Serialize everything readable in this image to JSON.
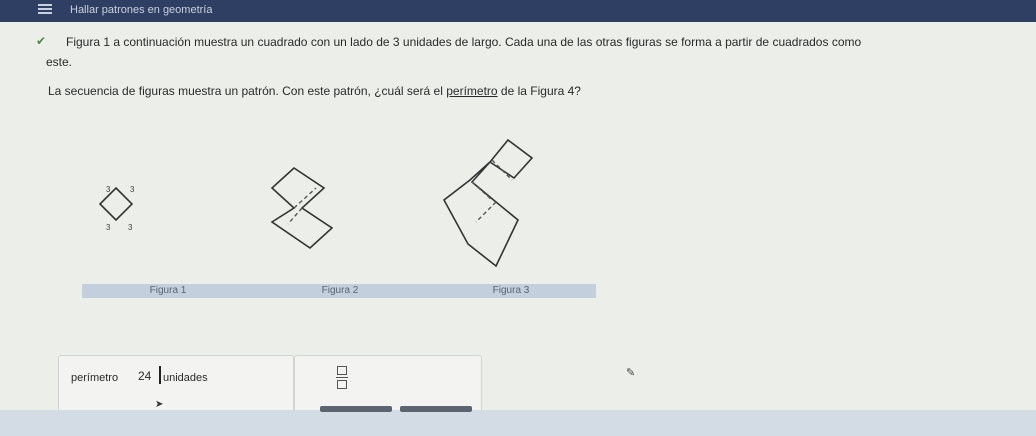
{
  "app_title": "Hallar patrones en geometría",
  "problem": {
    "line1": "Figura 1 a continuación muestra un cuadrado con un lado de 3 unidades de largo. Cada una de las otras figuras se forma a partir de cuadrados como",
    "line1b": "este.",
    "line2_pre": "La secuencia de figuras muestra un patrón. Con este patrón, ¿cuál será el ",
    "line2_underlined": "perímetro",
    "line2_post": " de la Figura 4?"
  },
  "figures": {
    "labels": [
      "Figura 1",
      "Figura 2",
      "Figura 3"
    ],
    "side_label": "3"
  },
  "answer": {
    "label": "perímetro",
    "value": "24",
    "units": "unidades"
  },
  "icons": {
    "menu": "menu-icon",
    "check": "check-icon",
    "fraction": "fraction-icon",
    "pencil": "pencil-icon",
    "cursor": "mouse-cursor-icon"
  }
}
